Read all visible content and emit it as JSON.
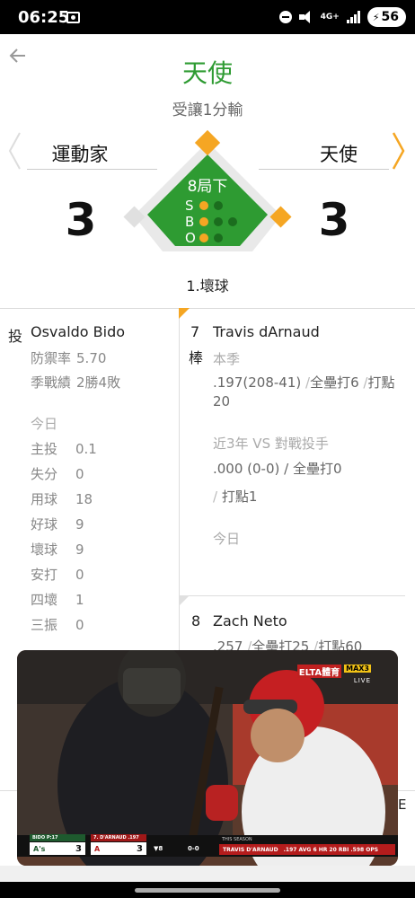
{
  "status_bar": {
    "time": "06:25",
    "network": "4G+",
    "battery": "56"
  },
  "header": {
    "favorite_team": "天使",
    "favorite_note": "受讓1分輸"
  },
  "scoreboard": {
    "away_team": "運動家",
    "home_team": "天使",
    "away_score": "3",
    "home_score": "3",
    "inning": "8局下",
    "count": {
      "strikes": {
        "label": "S",
        "on": 1,
        "max": 2
      },
      "balls": {
        "label": "B",
        "on": 1,
        "max": 3
      },
      "outs": {
        "label": "O",
        "on": 1,
        "max": 2
      }
    },
    "last_play": "1.壞球",
    "colors": {
      "field": "#2e9b32",
      "base_occupied": "#f5a623",
      "base_empty": "#ffffff",
      "accent": "#f5a623"
    }
  },
  "pitcher": {
    "tag": "投",
    "name": "Osvaldo Bido",
    "era_label": "防禦率",
    "era": "5.70",
    "record_label": "季戰績",
    "record": "2勝4敗",
    "today_label": "今日",
    "today_stats": [
      {
        "label": "主投",
        "value": "0.1",
        "strong": true
      },
      {
        "label": "失分",
        "value": "0",
        "strong": true
      },
      {
        "label": "用球",
        "value": "18",
        "strong": false
      },
      {
        "label": "好球",
        "value": "9",
        "strong": false
      },
      {
        "label": "壞球",
        "value": "9",
        "strong": false
      },
      {
        "label": "安打",
        "value": "0",
        "strong": false
      },
      {
        "label": "四壞",
        "value": "1",
        "strong": false
      },
      {
        "label": "三振",
        "value": "0",
        "strong": false
      }
    ]
  },
  "batter": {
    "order": "7",
    "tag": "棒",
    "name": "Travis dArnaud",
    "season_label": "本季",
    "season_avg": ".197(208-41)",
    "season_hr": "全壘打6",
    "season_rbi_a": "打點",
    "season_rbi_b": "20",
    "vs_label": "近3年 VS 對戰投手",
    "vs_avg": ".000 (0-0)",
    "vs_hr": "全壘打0",
    "vs_rbi": "打點1",
    "today_label": "今日"
  },
  "next_batter": {
    "order": "8",
    "name": "Zach Neto",
    "avg": ".257",
    "hr": "全壘打25",
    "rbi": "打點60"
  },
  "video": {
    "broadcaster": "ELTA體育",
    "channel": "MAX3",
    "live": "LIVE",
    "away_label": "BIDO P:17",
    "home_label": "7. D'ARNAUD .197",
    "away_abbr": "A's",
    "home_abbr": "A",
    "away_score": "3",
    "home_score": "3",
    "inning": "▼8",
    "count": "0-0",
    "season_tag": "THIS SEASON",
    "batter_line": "TRAVIS D'ARNAUD",
    "batter_stats": ".197 AVG  6 HR  20 RBI  .598 OPS"
  },
  "covered_text": "E"
}
